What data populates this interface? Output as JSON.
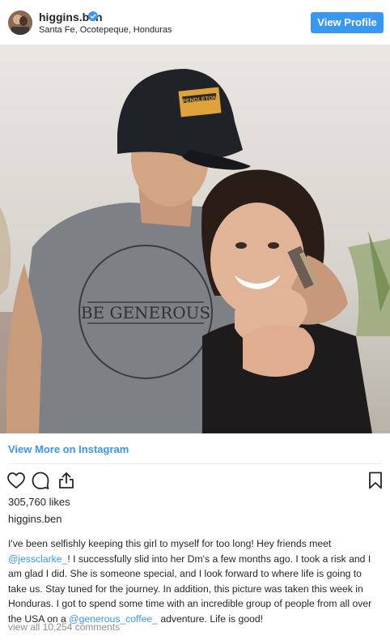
{
  "post": {
    "username": "higgins.ben",
    "location": "Santa Fe, Ocotepeque, Honduras",
    "view_profile_label": "View Profile",
    "view_more_label": "View More on Instagram",
    "likes_text": "305,760 likes",
    "caption_username": "higgins.ben",
    "caption_parts": {
      "p1": "I've been selfishly keeping this girl to myself for too long! Hey friends meet ",
      "mention1": "@jessclarke_",
      "p2": "! I successfully slid into her Dm's a few months ago. I took a risk and I am glad I did. She is someone special, and I look forward to where life is going to take us. Stay tuned for the journey. In addition, this picture was taken this week in Honduras. I got to spend some time with an incredible group of people from all over the USA on a ",
      "mention2": "@generous_coffee_",
      "p3": " adventure. Life is good!"
    },
    "view_comments_label": "view all 10,254 comments"
  },
  "photo": {
    "hat_patch_text": "PENDLETON",
    "shirt_text": "BE GENEROUS"
  },
  "icons": {
    "verified": "verified-badge-icon",
    "like": "heart-icon",
    "comment": "comment-bubble-icon",
    "share": "share-icon",
    "save": "bookmark-icon"
  },
  "colors": {
    "accent": "#3897f0",
    "text": "#262626",
    "muted": "#8e8e8e"
  }
}
